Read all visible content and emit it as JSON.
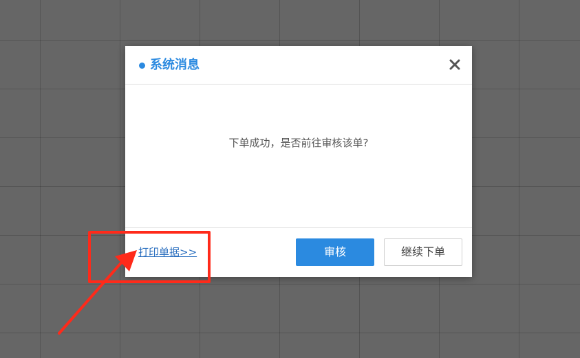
{
  "dialog": {
    "title": "系统消息",
    "close_icon": "close-icon",
    "message": "下单成功，是否前往审核该单?",
    "print_link": "打印单据>>",
    "buttons": {
      "primary_label": "审核",
      "secondary_label": "继续下单"
    }
  },
  "colors": {
    "accent": "#2b8ae0",
    "annotation": "#ff2a1a",
    "backdrop": "#666666"
  }
}
